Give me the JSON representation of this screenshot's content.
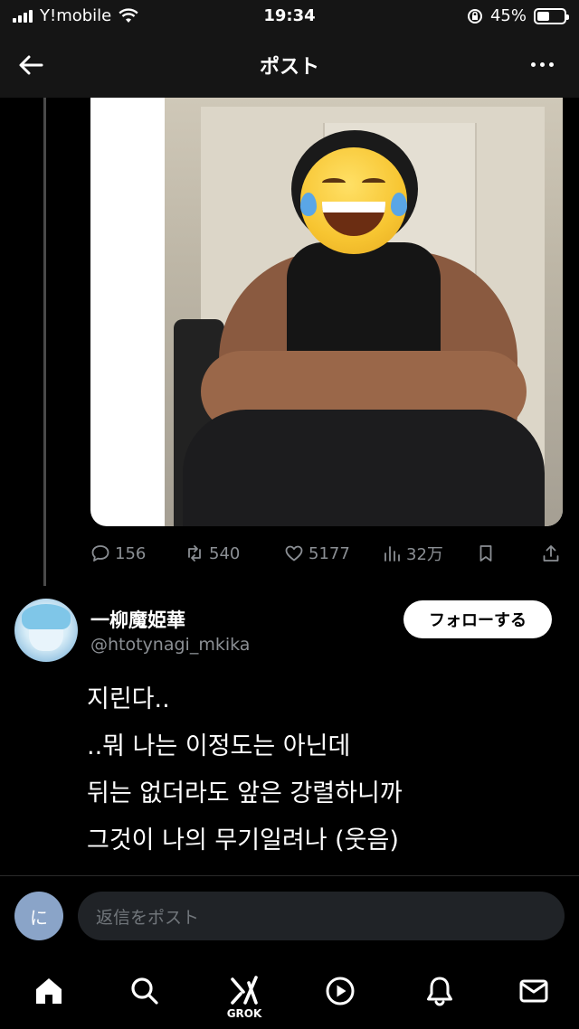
{
  "status_bar": {
    "carrier": "Y!mobile",
    "time": "19:34",
    "battery_percent": "45%",
    "battery_level": 0.45
  },
  "header": {
    "title": "ポスト"
  },
  "post": {
    "stats": {
      "replies": "156",
      "reposts": "540",
      "likes": "5177",
      "views": "32万"
    }
  },
  "reply": {
    "author_name": "一柳魔姫華",
    "author_handle": "@htotynagi_mkika",
    "follow_label": "フォローする",
    "lines": [
      "지린다..",
      "..뭐 나는 이정도는 아닌데",
      "뒤는 없더라도 앞은 강렬하니까",
      "그것이 나의 무기일려나 (웃음)"
    ]
  },
  "composer": {
    "avatar_initial": "に",
    "placeholder": "返信をポスト"
  },
  "nav": {
    "grok_label": "GROK"
  }
}
